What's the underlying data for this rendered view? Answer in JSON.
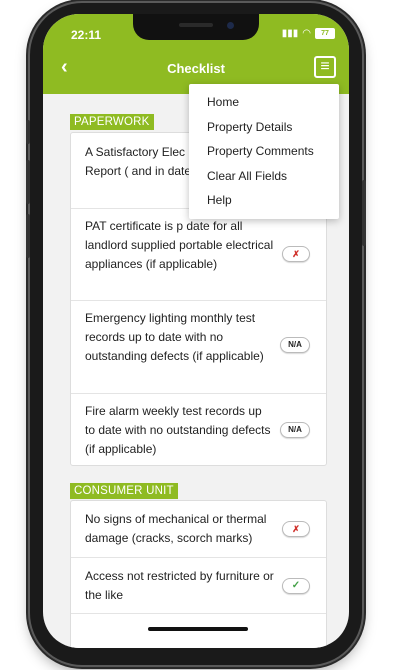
{
  "status": {
    "time": "22:11",
    "battery": "77"
  },
  "navbar": {
    "back_icon": "chevron-left-icon",
    "title": "Checklist",
    "menu_icon": "hamburger-icon"
  },
  "menu": {
    "items": [
      "Home",
      "Property Details",
      "Property Comments",
      "Clear All Fields",
      "Help"
    ]
  },
  "sections": [
    {
      "label": "PAPERWORK",
      "items": [
        {
          "text": "A Satisfactory Elec Condition Report ( and in date",
          "status": ""
        },
        {
          "text": "PAT certificate is p date for all landlord supplied portable electrical appliances (if applicable)",
          "status": "✗"
        },
        {
          "text": "Emergency lighting monthly test records up to date with no outstanding defects (if applicable)",
          "status": "N/A"
        },
        {
          "text": "Fire alarm weekly test records up to date with no outstanding defects (if applicable)",
          "status": "N/A"
        }
      ]
    },
    {
      "label": "CONSUMER UNIT",
      "items": [
        {
          "text": "No signs of mechanical or thermal damage (cracks, scorch marks)",
          "status": "✗"
        },
        {
          "text": "Access not restricted by furniture or the like",
          "status": "✓"
        }
      ]
    }
  ],
  "colors": {
    "accent": "#8fbb22",
    "fail": "#d0302a",
    "pass": "#43a047"
  }
}
